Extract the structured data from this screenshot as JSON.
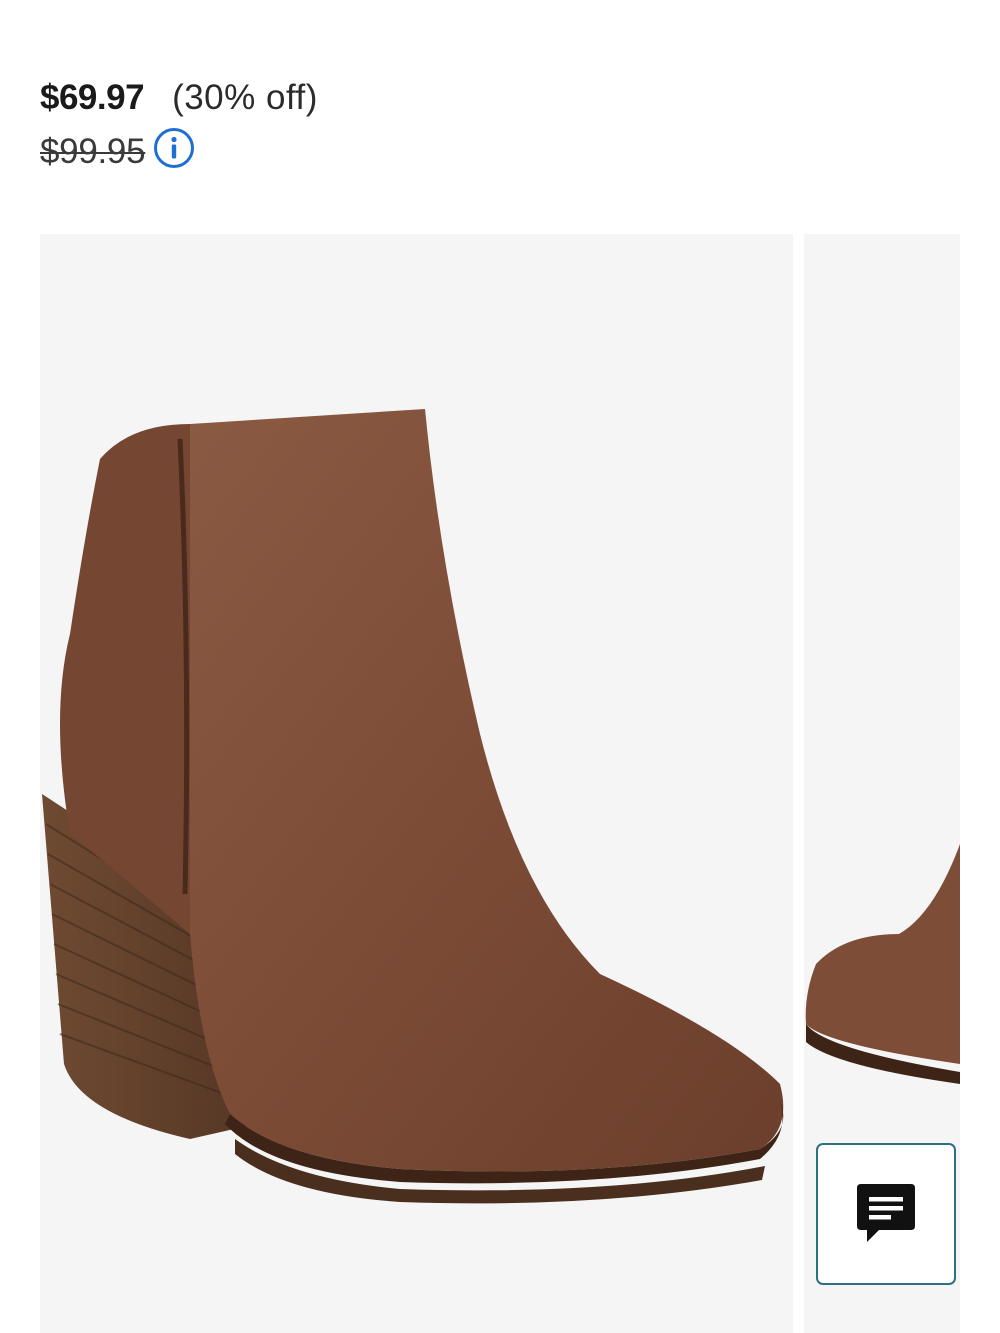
{
  "product": {
    "sale_price": "$69.97",
    "discount_text": "(30% off)",
    "original_price": "$99.95"
  },
  "icons": {
    "info": "info-circle-icon",
    "chat": "chat-bubble-icon"
  },
  "colors": {
    "accent_blue": "#1f6fd1",
    "chat_border": "#2f6f84",
    "boot_brown": "#7a4a35",
    "image_bg": "#f5f5f5"
  }
}
